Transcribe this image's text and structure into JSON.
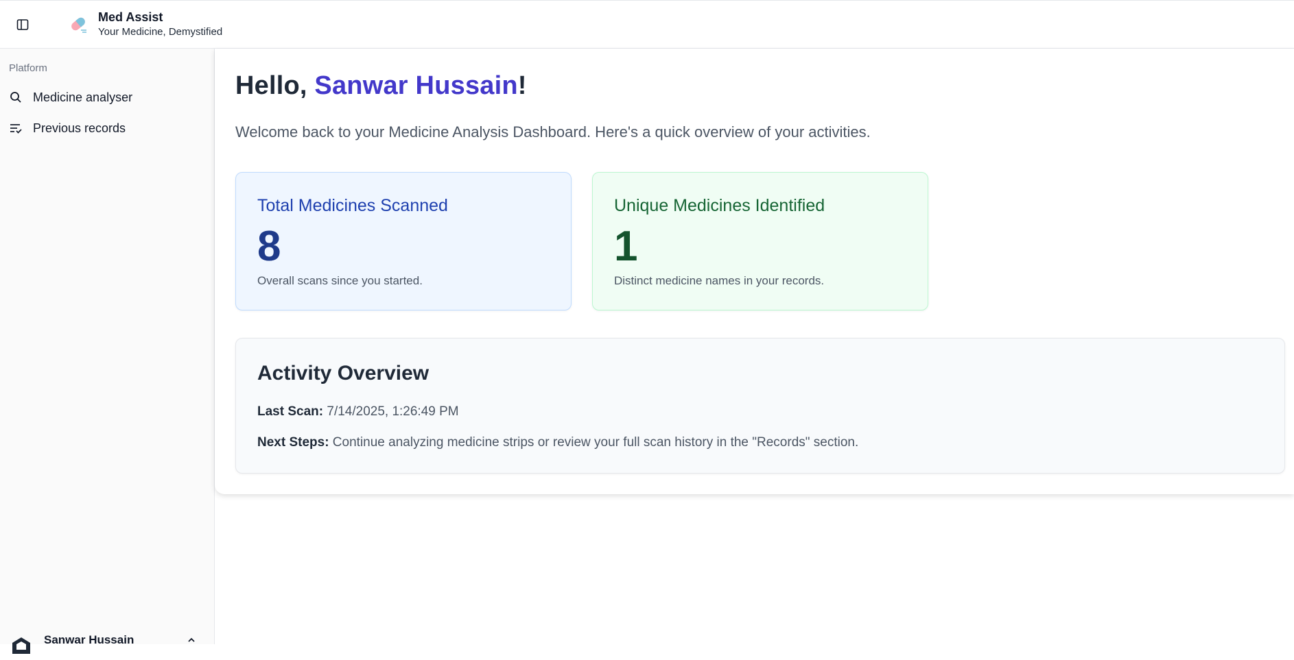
{
  "app": {
    "name": "Med Assist",
    "tagline": "Your Medicine, Demystified"
  },
  "sidebar": {
    "section_label": "Platform",
    "items": [
      {
        "label": "Medicine analyser",
        "icon": "search-icon"
      },
      {
        "label": "Previous records",
        "icon": "list-check-icon"
      }
    ],
    "user": {
      "name": "Sanwar Hussain",
      "icon": "chevron-up-icon"
    }
  },
  "main": {
    "greeting_prefix": "Hello, ",
    "greeting_name": "Sanwar Hussain",
    "greeting_suffix": "!",
    "welcome": "Welcome back to your Medicine Analysis Dashboard. Here's a quick overview of your activities.",
    "cards": [
      {
        "title": "Total Medicines Scanned",
        "value": "8",
        "desc": "Overall scans since you started."
      },
      {
        "title": "Unique Medicines Identified",
        "value": "1",
        "desc": "Distinct medicine names in your records."
      }
    ],
    "activity": {
      "title": "Activity Overview",
      "last_scan_label": "Last Scan:",
      "last_scan_value": " 7/14/2025, 1:26:49 PM",
      "next_steps_label": "Next Steps:",
      "next_steps_value": " Continue analyzing medicine strips or review your full scan history in the \"Records\" section."
    }
  },
  "colors": {
    "accent": "#4338ca",
    "card_blue_bg": "#eff6ff",
    "card_green_bg": "#f0fdf4"
  }
}
